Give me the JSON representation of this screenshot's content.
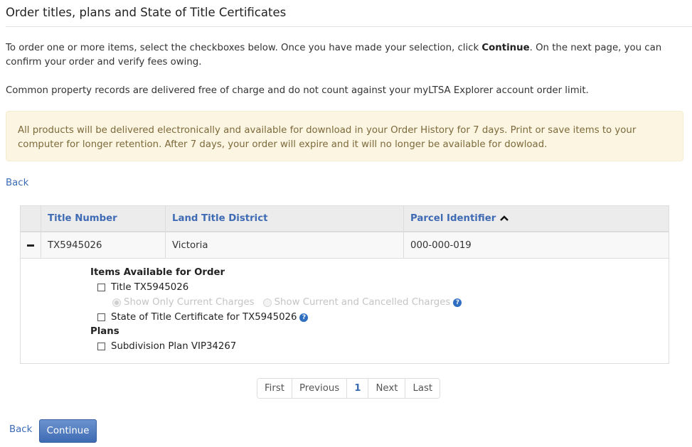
{
  "page": {
    "title": "Order titles, plans and State of Title Certificates"
  },
  "intro": {
    "before_bold": "To order one or more items, select the checkboxes below. Once you have made your selection, click ",
    "bold": "Continue",
    "after_bold": ". On the next page, you can confirm your order and verify fees owing.",
    "common_property": "Common property records are delivered free of charge and do not count against your myLTSA Explorer account order limit."
  },
  "alert": {
    "text": "All products will be delivered electronically and available for download in your Order History for 7 days. Print or save items to your computer for longer retention. After 7 days, your order will expire and it will no longer be available for dowload."
  },
  "nav": {
    "back_label": "Back",
    "continue_label": "Continue"
  },
  "grid": {
    "columns": [
      {
        "label": "Title Number",
        "sortable": true
      },
      {
        "label": "Land Title District",
        "sortable": true
      },
      {
        "label": "Parcel Identifier",
        "sortable": true,
        "sort": "ascending",
        "sort_icon": "chevron-up-icon"
      }
    ],
    "rows": [
      {
        "expanded": true,
        "expand_icon": "minus-icon",
        "title_number": "TX5945026",
        "district": "Victoria",
        "pid": "000-000-019",
        "details": {
          "items_heading": "Items Available for Order",
          "title_item": {
            "label": "Title TX5945026",
            "checked": false
          },
          "charges_options": [
            {
              "label": "Show Only Current Charges",
              "selected": true,
              "disabled": true
            },
            {
              "label": "Show Current and Cancelled Charges",
              "selected": false,
              "disabled": true
            }
          ],
          "charges_help_icon": "question-circle-icon",
          "sotc_item": {
            "label": "State of Title Certificate for TX5945026",
            "checked": false
          },
          "sotc_help_icon": "question-circle-icon",
          "plans_heading": "Plans",
          "plan_item": {
            "label": "Subdivision Plan VIP34267",
            "checked": false
          }
        }
      }
    ]
  },
  "pager": {
    "first": "First",
    "previous": "Previous",
    "current_page": "1",
    "next": "Next",
    "last": "Last"
  },
  "colors": {
    "link": "#3a6bb5",
    "alert_bg": "#fcf5e1",
    "alert_text": "#7d6a3c",
    "button": "#4a74bb"
  }
}
